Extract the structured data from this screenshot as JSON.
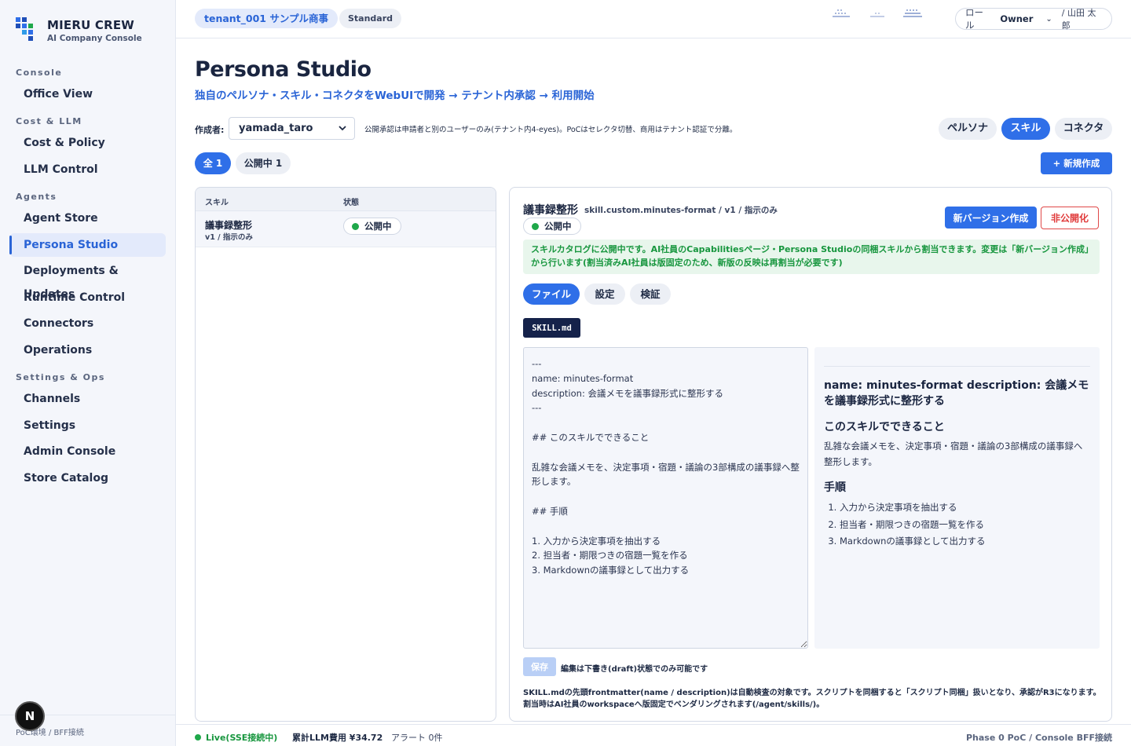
{
  "brand": {
    "name": "MIERU CREW",
    "subtitle": "AI Company Console"
  },
  "sidebar": {
    "groups": [
      {
        "label": "Console",
        "items": [
          "Office View"
        ]
      },
      {
        "label": "Cost & LLM",
        "items": [
          "Cost & Policy",
          "LLM Control"
        ]
      },
      {
        "label": "Agents",
        "items": [
          "Agent Store",
          "Persona Studio",
          "Deployments & Updates",
          "Runtime Control",
          "Connectors",
          "Operations"
        ]
      },
      {
        "label": "Settings & Ops",
        "items": [
          "Channels",
          "Settings",
          "Admin Console",
          "Store Catalog"
        ]
      }
    ],
    "active": "Persona Studio",
    "footer": "PoC環境 / BFF接続",
    "avatar_letter": "N"
  },
  "topbar": {
    "tenant": "tenant_001 サンプル商事",
    "plan": "Standard",
    "role_label": "ロール",
    "role_value": "Owner",
    "user": "/ 山田 太郎"
  },
  "page": {
    "title": "Persona Studio",
    "subtitle": "独自のペルソナ・スキル・コネクタをWebUIで開発 → テナント内承認 → 利用開始",
    "author_label": "作成者:",
    "author_value": "yamada_taro",
    "approval_note": "公開承認は申請者と別のユーザーのみ(テナント内4-eyes)。PoCはセレクタ切替、商用はテナント認証で分離。",
    "segments": [
      "ペルソナ",
      "スキル",
      "コネクタ"
    ],
    "active_segment": "スキル",
    "filters": [
      "全 1",
      "公開中 1"
    ],
    "new_button": "+ 新規作成"
  },
  "list": {
    "columns": [
      "スキル",
      "状態"
    ],
    "rows": [
      {
        "name": "議事録整形",
        "version": "v1 / 指示のみ",
        "status": "公開中"
      }
    ]
  },
  "detail": {
    "title": "議事録整形",
    "meta": "skill.custom.minutes-format / v1 / 指示のみ",
    "status": "公開中",
    "new_version_button": "新バージョン作成",
    "unpublish_button": "非公開化",
    "notice": "スキルカタログに公開中です。AI社員のCapabilitiesページ・Persona Studioの同梱スキルから割当できます。変更は「新バージョン作成」から行います(割当済みAI社員は版固定のため、新版の反映は再割当が必要です)",
    "tabs": [
      "ファイル",
      "設定",
      "検証"
    ],
    "active_tab": "ファイル",
    "file_name": "SKILL.md",
    "editor_text": "---\nname: minutes-format\ndescription: 会議メモを議事録形式に整形する\n---\n\n## このスキルでできること\n\n乱雑な会議メモを、決定事項・宿題・議論の3部構成の議事録へ整形します。\n\n## 手順\n\n1. 入力から決定事項を抽出する\n2. 担当者・期限つきの宿題一覧を作る\n3. Markdownの議事録として出力する",
    "preview": {
      "h1": "name: minutes-format description: 会議メモを議事録形式に整形する",
      "h2a": "このスキルでできること",
      "p": "乱雑な会議メモを、決定事項・宿題・議論の3部構成の議事録へ整形します。",
      "h2b": "手順",
      "steps": [
        "入力から決定事項を抽出する",
        "担当者・期限つきの宿題一覧を作る",
        "Markdownの議事録として出力する"
      ]
    },
    "save_button": "保存",
    "save_note": "編集は下書き(draft)状態でのみ可能です",
    "footnote": "SKILL.mdの先頭frontmatter(name / description)は自動検査の対象です。スクリプトを同梱すると「スクリプト同梱」扱いとなり、承認がR3になります。割当時はAI社員のworkspaceへ版固定でベンダリングされます(/agent/skills/)。"
  },
  "footer": {
    "live": "Live(SSE接続中)",
    "cost": "累計LLM費用 ¥34.72",
    "alerts": "アラート 0件",
    "phase": "Phase 0 PoC / Console BFF接続"
  },
  "colors": {
    "accent": "#2f6fe8",
    "success": "#1fa84a",
    "danger": "#e03a3a",
    "navy": "#15224a"
  }
}
